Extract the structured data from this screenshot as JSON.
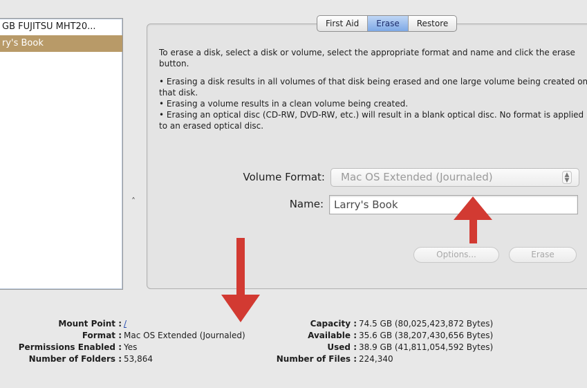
{
  "sidebar": {
    "disks": [
      {
        "label": "GB FUJITSU MHT20...",
        "selected": false
      },
      {
        "label": "ry's Book",
        "selected": true
      }
    ],
    "splitter_glyph": "˄"
  },
  "tabs": [
    {
      "label": "First Aid",
      "active": false
    },
    {
      "label": "Erase",
      "active": true
    },
    {
      "label": "Restore",
      "active": false
    }
  ],
  "erase_panel": {
    "intro": "To erase a disk, select a disk or volume, select the appropriate format and name and click the erase button.",
    "bullets": [
      "• Erasing a disk results in all volumes of that disk being erased and one large volume being created on that disk.",
      "• Erasing a volume results in a clean volume being created.",
      "• Erasing an optical disc (CD-RW, DVD-RW, etc.) will result in a blank optical disc. No format is applied to an erased optical disc."
    ],
    "volume_format_label": "Volume Format:",
    "volume_format_value": "Mac OS Extended (Journaled)",
    "name_label": "Name:",
    "name_value": "Larry's Book",
    "options_button": "Options...",
    "erase_button": "Erase"
  },
  "info": {
    "left": [
      {
        "label": "Mount Point :",
        "value": "/"
      },
      {
        "label": "Format :",
        "value": "Mac OS Extended (Journaled)"
      },
      {
        "label": "Permissions Enabled :",
        "value": "Yes"
      },
      {
        "label": "Number of Folders :",
        "value": "53,864"
      }
    ],
    "right": [
      {
        "label": "Capacity :",
        "value": "74.5 GB (80,025,423,872 Bytes)"
      },
      {
        "label": "Available :",
        "value": "35.6 GB (38,207,430,656 Bytes)"
      },
      {
        "label": "Used :",
        "value": "38.9 GB (41,811,054,592 Bytes)"
      },
      {
        "label": "Number of Files :",
        "value": "224,340"
      }
    ]
  },
  "colors": {
    "annotation_arrow": "#d23a32",
    "selected_row": "#b89a68",
    "active_tab": "#7ea9e6"
  }
}
